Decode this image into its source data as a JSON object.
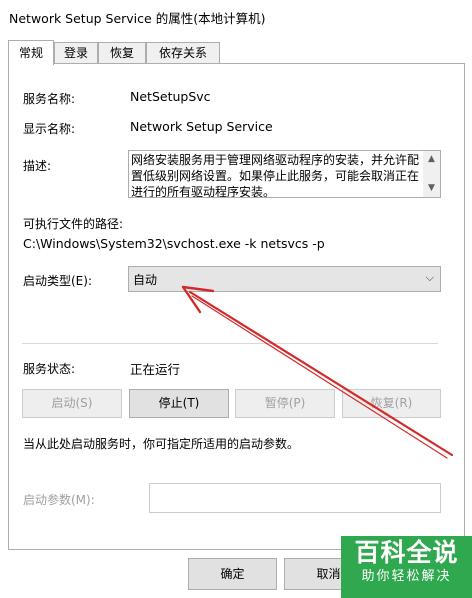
{
  "window": {
    "title": "Network Setup Service 的属性(本地计算机)"
  },
  "tabs": [
    "常规",
    "登录",
    "恢复",
    "依存关系"
  ],
  "general": {
    "service_name_label": "服务名称:",
    "service_name": "NetSetupSvc",
    "display_name_label": "显示名称:",
    "display_name": "Network Setup Service",
    "description_label": "描述:",
    "description": "网络安装服务用于管理网络驱动程序的安装，并允许配置低级别网络设置。如果停止此服务，可能会取消正在进行的所有驱动程序安装。",
    "exe_path_label": "可执行文件的路径:",
    "exe_path": "C:\\Windows\\System32\\svchost.exe -k netsvcs -p",
    "startup_type_label": "启动类型(E):",
    "startup_type": "自动",
    "status_label": "服务状态:",
    "status": "正在运行",
    "buttons": {
      "start": "启动(S)",
      "stop": "停止(T)",
      "pause": "暂停(P)",
      "resume": "恢复(R)"
    },
    "hint": "当从此处启动服务时，你可指定所适用的启动参数。",
    "params_label": "启动参数(M):",
    "params_value": ""
  },
  "footer": {
    "ok": "确定",
    "cancel": "取消"
  },
  "watermark": {
    "main": "百科全说",
    "sub": "助你轻松解决"
  },
  "colors": {
    "annotation_arrow": "#d42a2a",
    "watermark_bg": "#2fa84f"
  }
}
